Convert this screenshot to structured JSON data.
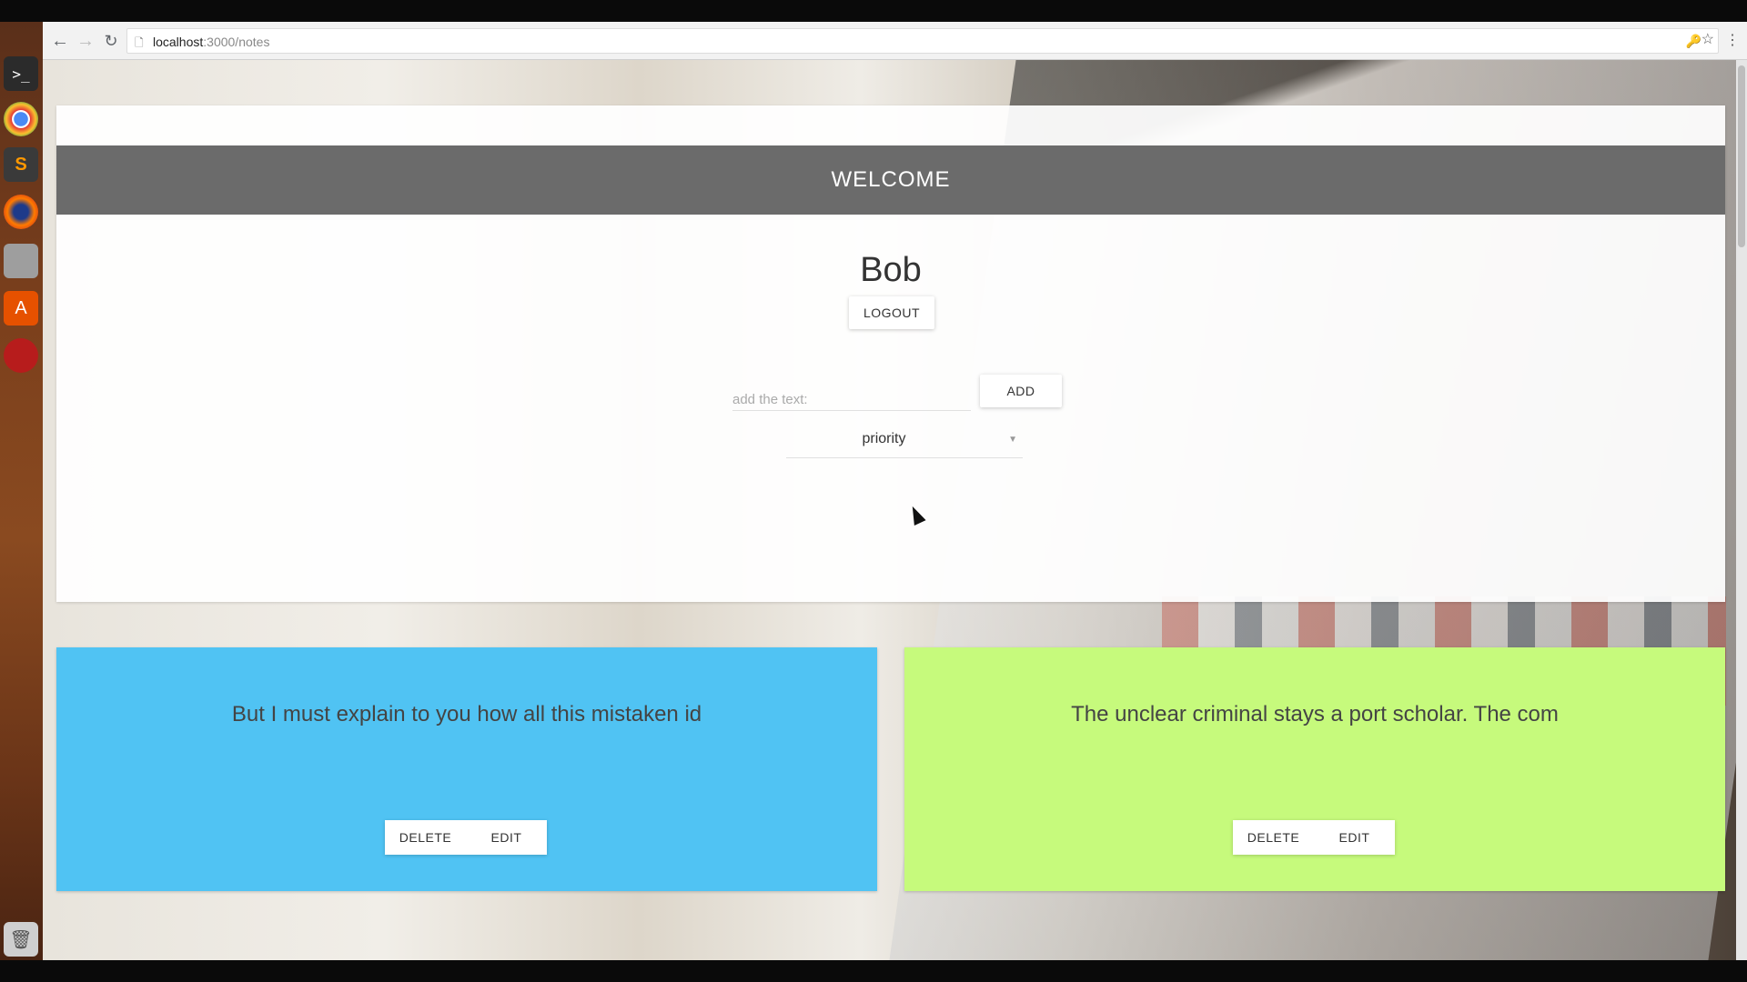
{
  "browser": {
    "url_host": "localhost",
    "url_path": ":3000/notes",
    "back_icon": "arrow-left-icon",
    "forward_icon": "arrow-right-icon",
    "reload_icon": "reload-icon"
  },
  "launcher": {
    "terminal_glyph": ">_",
    "sublime_glyph": "S",
    "store_glyph": "A"
  },
  "header": {
    "welcome": "WELCOME"
  },
  "user": {
    "name": "Bob",
    "logout_label": "LOGOUT"
  },
  "add_form": {
    "placeholder": "add the text:",
    "value": "",
    "add_label": "ADD",
    "priority_selected": "priority"
  },
  "notes": [
    {
      "text": "But I must explain to you how all this mistaken id",
      "color": "#50c3f3",
      "delete_label": "DELETE",
      "edit_label": "EDIT"
    },
    {
      "text": "The unclear criminal stays a port scholar. The com",
      "color": "#c6fa7c",
      "delete_label": "DELETE",
      "edit_label": "EDIT"
    }
  ]
}
